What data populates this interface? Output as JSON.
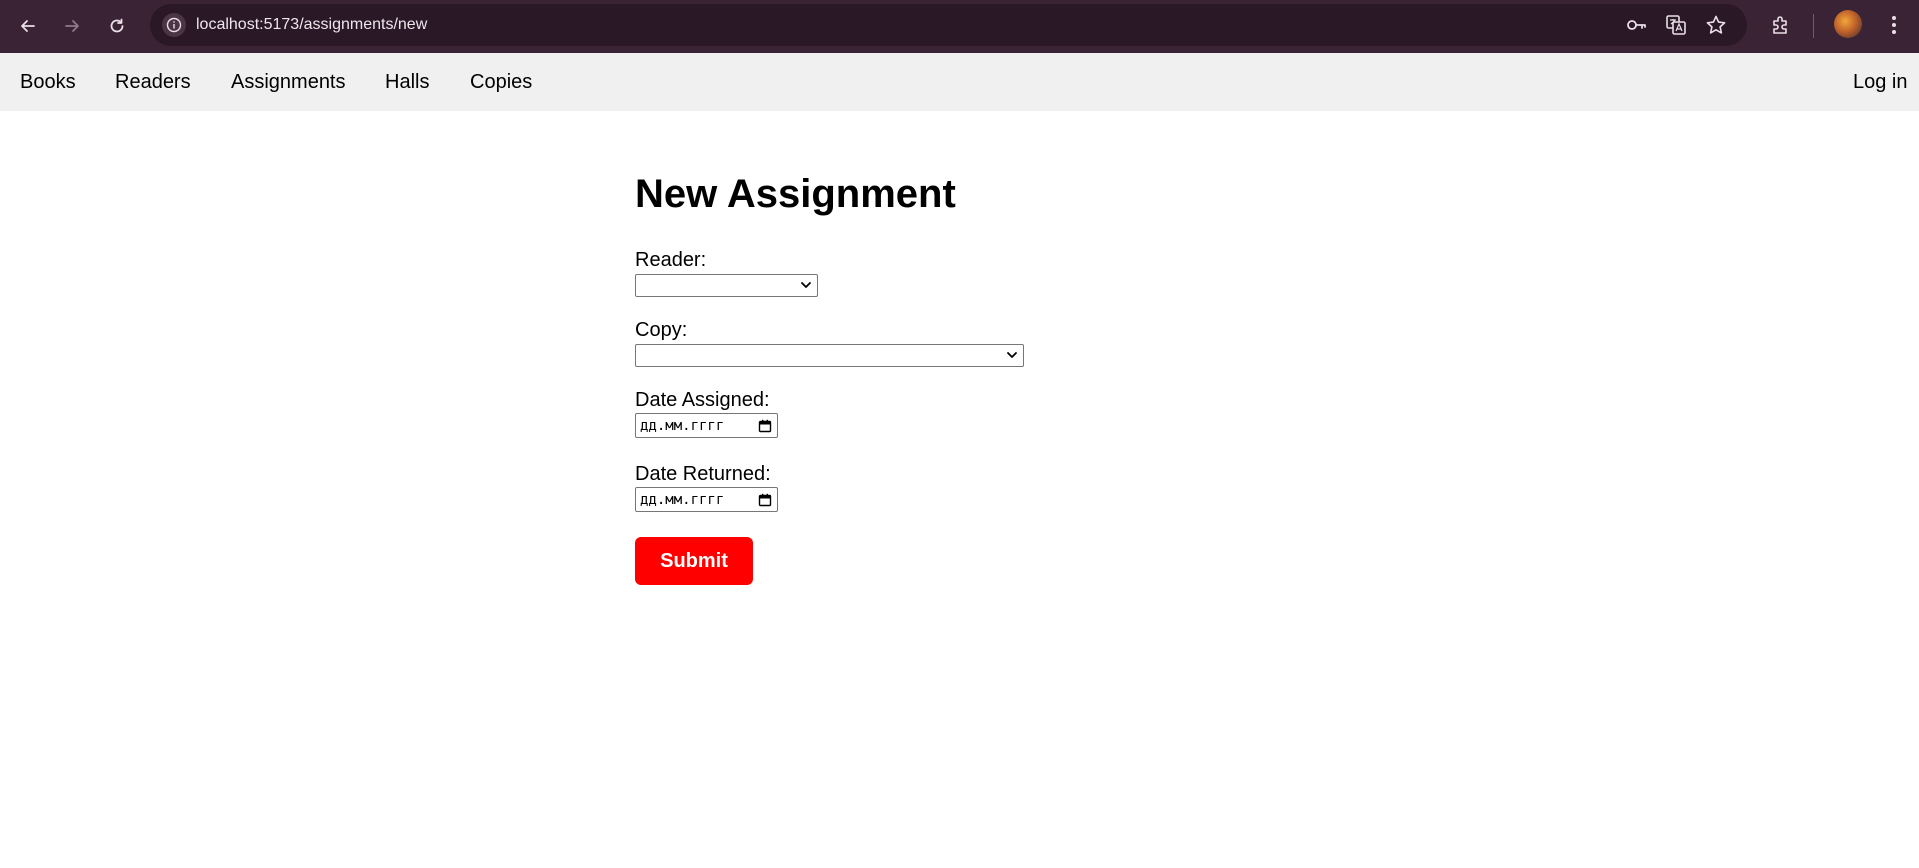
{
  "browser": {
    "url": "localhost:5173/assignments/new",
    "icons": [
      "back-icon",
      "forward-icon",
      "reload-icon",
      "site-info-icon",
      "key-icon",
      "translate-icon",
      "star-icon",
      "extensions-icon",
      "avatar",
      "more-icon"
    ]
  },
  "nav": {
    "books": "Books",
    "readers": "Readers",
    "assignments": "Assignments",
    "halls": "Halls",
    "copies": "Copies",
    "login": "Log in"
  },
  "form": {
    "title": "New Assignment",
    "reader_label": "Reader:",
    "reader_value": "",
    "copy_label": "Copy:",
    "copy_value": "",
    "date_assigned_label": "Date Assigned:",
    "date_assigned_placeholder": "дд.мм.гггг",
    "date_returned_label": "Date Returned:",
    "date_returned_placeholder": "дд.мм.гггг",
    "submit_label": "Submit"
  },
  "colors": {
    "chrome_bg": "#3a2335",
    "nav_bg": "#f0f0f0",
    "submit_bg": "#ff0000"
  }
}
